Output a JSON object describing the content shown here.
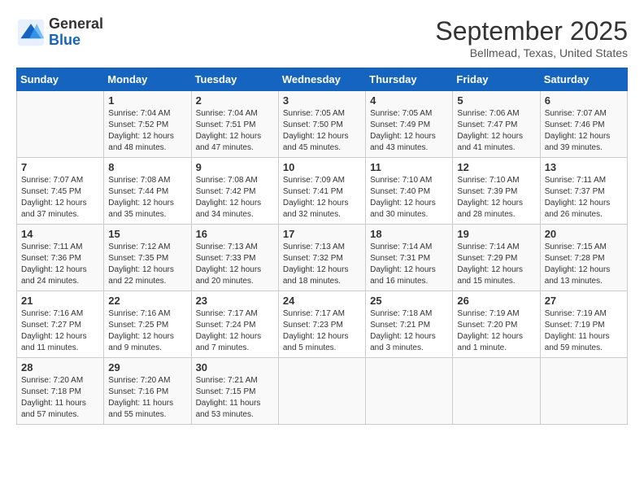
{
  "header": {
    "logo_general": "General",
    "logo_blue": "Blue",
    "month_title": "September 2025",
    "location": "Bellmead, Texas, United States"
  },
  "days_of_week": [
    "Sunday",
    "Monday",
    "Tuesday",
    "Wednesday",
    "Thursday",
    "Friday",
    "Saturday"
  ],
  "weeks": [
    [
      {
        "day": "",
        "info": ""
      },
      {
        "day": "1",
        "info": "Sunrise: 7:04 AM\nSunset: 7:52 PM\nDaylight: 12 hours\nand 48 minutes."
      },
      {
        "day": "2",
        "info": "Sunrise: 7:04 AM\nSunset: 7:51 PM\nDaylight: 12 hours\nand 47 minutes."
      },
      {
        "day": "3",
        "info": "Sunrise: 7:05 AM\nSunset: 7:50 PM\nDaylight: 12 hours\nand 45 minutes."
      },
      {
        "day": "4",
        "info": "Sunrise: 7:05 AM\nSunset: 7:49 PM\nDaylight: 12 hours\nand 43 minutes."
      },
      {
        "day": "5",
        "info": "Sunrise: 7:06 AM\nSunset: 7:47 PM\nDaylight: 12 hours\nand 41 minutes."
      },
      {
        "day": "6",
        "info": "Sunrise: 7:07 AM\nSunset: 7:46 PM\nDaylight: 12 hours\nand 39 minutes."
      }
    ],
    [
      {
        "day": "7",
        "info": "Sunrise: 7:07 AM\nSunset: 7:45 PM\nDaylight: 12 hours\nand 37 minutes."
      },
      {
        "day": "8",
        "info": "Sunrise: 7:08 AM\nSunset: 7:44 PM\nDaylight: 12 hours\nand 35 minutes."
      },
      {
        "day": "9",
        "info": "Sunrise: 7:08 AM\nSunset: 7:42 PM\nDaylight: 12 hours\nand 34 minutes."
      },
      {
        "day": "10",
        "info": "Sunrise: 7:09 AM\nSunset: 7:41 PM\nDaylight: 12 hours\nand 32 minutes."
      },
      {
        "day": "11",
        "info": "Sunrise: 7:10 AM\nSunset: 7:40 PM\nDaylight: 12 hours\nand 30 minutes."
      },
      {
        "day": "12",
        "info": "Sunrise: 7:10 AM\nSunset: 7:39 PM\nDaylight: 12 hours\nand 28 minutes."
      },
      {
        "day": "13",
        "info": "Sunrise: 7:11 AM\nSunset: 7:37 PM\nDaylight: 12 hours\nand 26 minutes."
      }
    ],
    [
      {
        "day": "14",
        "info": "Sunrise: 7:11 AM\nSunset: 7:36 PM\nDaylight: 12 hours\nand 24 minutes."
      },
      {
        "day": "15",
        "info": "Sunrise: 7:12 AM\nSunset: 7:35 PM\nDaylight: 12 hours\nand 22 minutes."
      },
      {
        "day": "16",
        "info": "Sunrise: 7:13 AM\nSunset: 7:33 PM\nDaylight: 12 hours\nand 20 minutes."
      },
      {
        "day": "17",
        "info": "Sunrise: 7:13 AM\nSunset: 7:32 PM\nDaylight: 12 hours\nand 18 minutes."
      },
      {
        "day": "18",
        "info": "Sunrise: 7:14 AM\nSunset: 7:31 PM\nDaylight: 12 hours\nand 16 minutes."
      },
      {
        "day": "19",
        "info": "Sunrise: 7:14 AM\nSunset: 7:29 PM\nDaylight: 12 hours\nand 15 minutes."
      },
      {
        "day": "20",
        "info": "Sunrise: 7:15 AM\nSunset: 7:28 PM\nDaylight: 12 hours\nand 13 minutes."
      }
    ],
    [
      {
        "day": "21",
        "info": "Sunrise: 7:16 AM\nSunset: 7:27 PM\nDaylight: 12 hours\nand 11 minutes."
      },
      {
        "day": "22",
        "info": "Sunrise: 7:16 AM\nSunset: 7:25 PM\nDaylight: 12 hours\nand 9 minutes."
      },
      {
        "day": "23",
        "info": "Sunrise: 7:17 AM\nSunset: 7:24 PM\nDaylight: 12 hours\nand 7 minutes."
      },
      {
        "day": "24",
        "info": "Sunrise: 7:17 AM\nSunset: 7:23 PM\nDaylight: 12 hours\nand 5 minutes."
      },
      {
        "day": "25",
        "info": "Sunrise: 7:18 AM\nSunset: 7:21 PM\nDaylight: 12 hours\nand 3 minutes."
      },
      {
        "day": "26",
        "info": "Sunrise: 7:19 AM\nSunset: 7:20 PM\nDaylight: 12 hours\nand 1 minute."
      },
      {
        "day": "27",
        "info": "Sunrise: 7:19 AM\nSunset: 7:19 PM\nDaylight: 11 hours\nand 59 minutes."
      }
    ],
    [
      {
        "day": "28",
        "info": "Sunrise: 7:20 AM\nSunset: 7:18 PM\nDaylight: 11 hours\nand 57 minutes."
      },
      {
        "day": "29",
        "info": "Sunrise: 7:20 AM\nSunset: 7:16 PM\nDaylight: 11 hours\nand 55 minutes."
      },
      {
        "day": "30",
        "info": "Sunrise: 7:21 AM\nSunset: 7:15 PM\nDaylight: 11 hours\nand 53 minutes."
      },
      {
        "day": "",
        "info": ""
      },
      {
        "day": "",
        "info": ""
      },
      {
        "day": "",
        "info": ""
      },
      {
        "day": "",
        "info": ""
      }
    ]
  ]
}
